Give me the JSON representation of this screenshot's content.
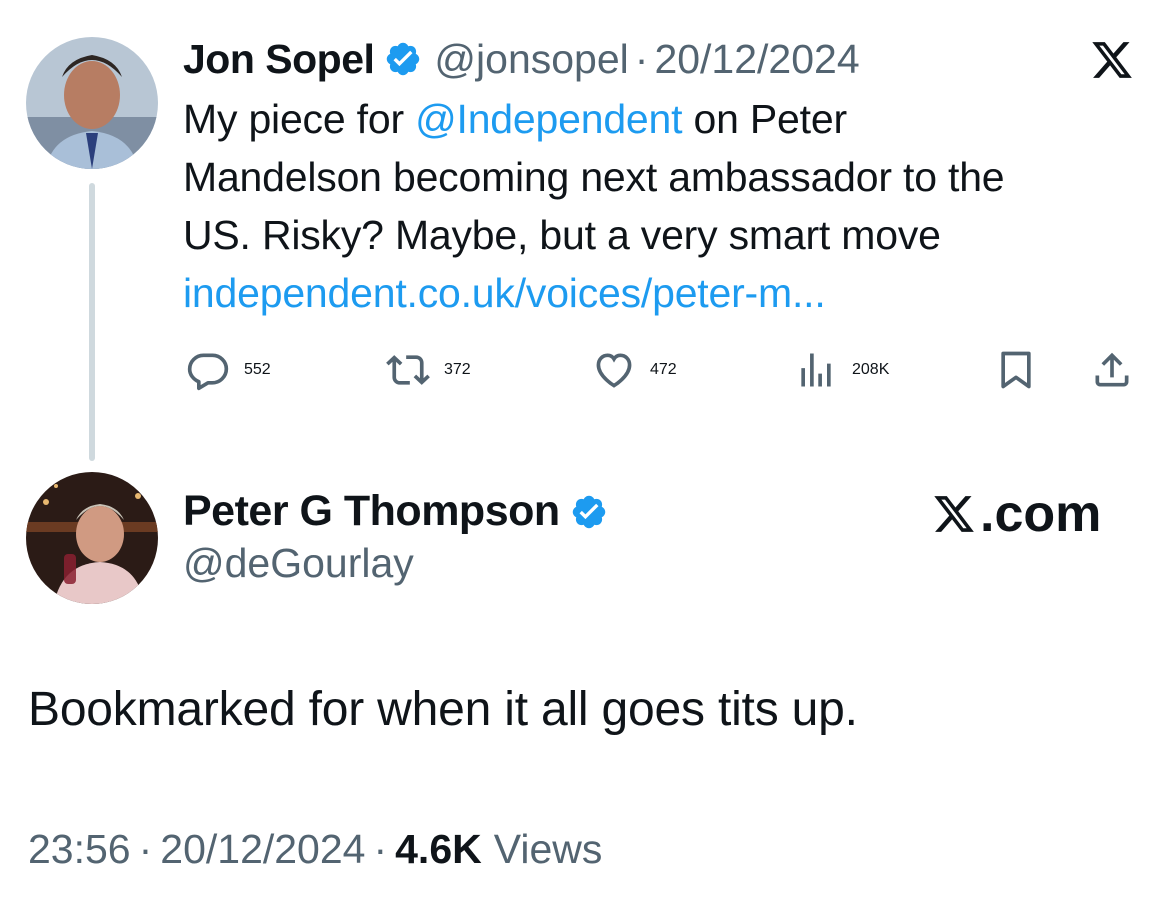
{
  "quoted_tweet": {
    "author_name": "Jon Sopel",
    "handle": "@jonsopel",
    "separator": "·",
    "date": "20/12/2024",
    "avatar_icon": "user-avatar-photo",
    "verified_icon": "verified-badge-icon",
    "platform_icon": "x-logo-icon",
    "body_lines": {
      "line1_prefix": "My piece for ",
      "line1_mention": "@Independent",
      "line1_suffix": " on Peter",
      "line2": "Mandelson becoming next ambassador to the",
      "line3": "US. Risky? Maybe, but a very smart move",
      "line4_link": "independent.co.uk/voices/peter-m..."
    },
    "actions": {
      "replies": "552",
      "reposts": "372",
      "likes": "472",
      "views": "208K"
    }
  },
  "reply_tweet": {
    "author_name": "Peter G Thompson",
    "handle": "@deGourlay",
    "site_label": ".com",
    "text": "Bookmarked for when it all goes tits up.",
    "time": "23:56",
    "separator": "·",
    "date": "20/12/2024",
    "views_count": "4.6K",
    "views_label": "Views"
  },
  "colors": {
    "accent": "#1d9bf0",
    "text": "#0f1419",
    "muted": "#536471",
    "thread_line": "#cfd9de"
  }
}
